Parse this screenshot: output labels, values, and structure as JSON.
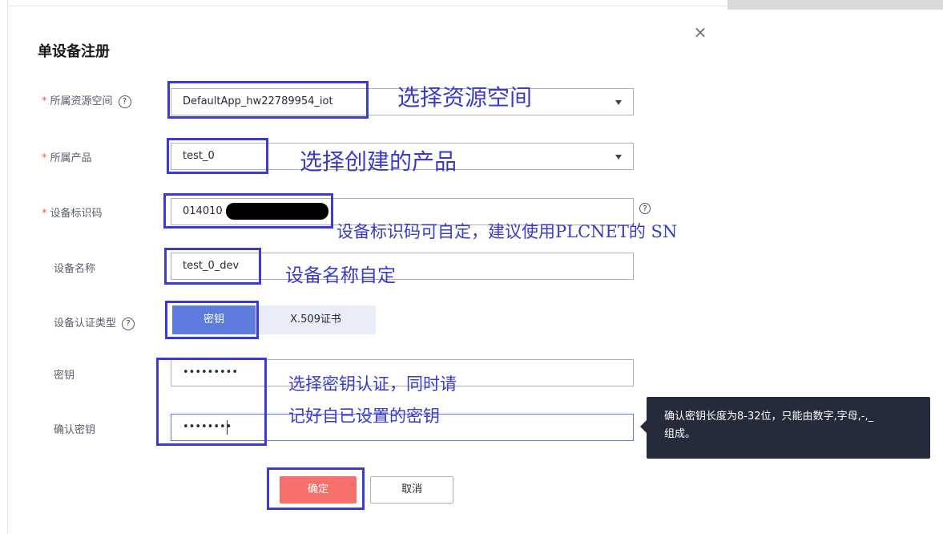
{
  "dialog": {
    "title": "单设备注册",
    "close_glyph": "×"
  },
  "form": {
    "space": {
      "label": "所属资源空间",
      "value": "DefaultApp_hw22789954_iot",
      "required_mark": "*",
      "help_glyph": "?"
    },
    "product": {
      "label": "所属产品",
      "value": "test_0",
      "required_mark": "*"
    },
    "device_id": {
      "label": "设备标识码",
      "value": "014010",
      "required_mark": "*",
      "help_glyph": "?"
    },
    "device_name": {
      "label": "设备名称",
      "value": "test_0_dev"
    },
    "auth_type": {
      "label": "设备认证类型",
      "help_glyph": "?",
      "options": [
        "密钥",
        "X.509证书"
      ],
      "selected": "密钥"
    },
    "secret": {
      "label": "密钥",
      "value": "•••••••••"
    },
    "confirm_secret": {
      "label": "确认密钥",
      "value": "••••••••"
    }
  },
  "tooltip": {
    "line1": "确认密钥长度为8-32位，只能由数字,字母,-,_",
    "line2": "组成。"
  },
  "buttons": {
    "ok": "确定",
    "cancel": "取消"
  },
  "annotations": {
    "space": "选择资源空间",
    "product": "选择创建的产品",
    "device_id": "设备标识码可自定，建议使用PLCNET的 SN",
    "device_name": "设备名称自定",
    "secret_line1": "选择密钥认证，同时请",
    "secret_line2": "记好自已设置的密钥"
  },
  "colors": {
    "primary": "#5e7ce0",
    "danger": "#f66f6a",
    "annotation": "#3a3acb",
    "tooltip_bg": "#252b3a"
  }
}
